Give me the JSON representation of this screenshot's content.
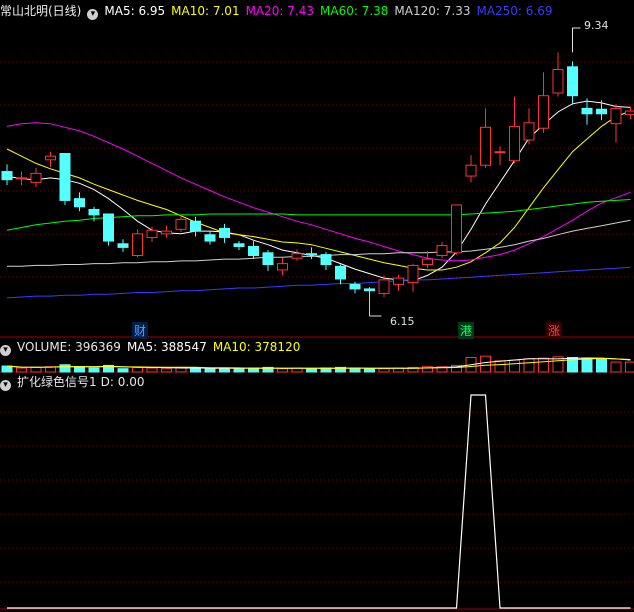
{
  "main": {
    "stock_name": "常山北明(日线)",
    "ma": [
      {
        "label": "MA5:",
        "value": "6.95",
        "color": "#ffffff"
      },
      {
        "label": "MA10:",
        "value": "7.01",
        "color": "#ffff00"
      },
      {
        "label": "MA20:",
        "value": "7.43",
        "color": "#ff00ff"
      },
      {
        "label": "MA60:",
        "value": "7.38",
        "color": "#00ff00"
      },
      {
        "label": "MA120:",
        "value": "7.33",
        "color": "#cfcfcf"
      },
      {
        "label": "MA250:",
        "value": "6.69",
        "color": "#3a3aff"
      }
    ],
    "high_label": "9.34",
    "low_label": "6.15",
    "markers": [
      {
        "text": "财",
        "color": "#4aa3ff",
        "bg": "#00204a"
      },
      {
        "text": "港",
        "color": "#00ff66",
        "bg": "#003a18"
      },
      {
        "text": "涨",
        "color": "#ff4040",
        "bg": "#3a0000"
      }
    ]
  },
  "volume": {
    "label": "VOLUME:",
    "value": "396369",
    "ma5_label": "MA5:",
    "ma5_value": "388547",
    "ma10_label": "MA10:",
    "ma10_value": "378120"
  },
  "indicator": {
    "name": "扩化绿色信号1",
    "d_label": "D:",
    "d_value": "0.00"
  },
  "chart_data": {
    "type": "candlestick",
    "y_high": 9.34,
    "y_low": 6.15,
    "candles": [
      [
        7.75,
        7.66,
        7.83,
        7.6
      ],
      [
        7.68,
        7.68,
        7.75,
        7.6
      ],
      [
        7.63,
        7.73,
        7.79,
        7.58
      ],
      [
        7.88,
        7.92,
        7.97,
        7.8
      ],
      [
        7.95,
        7.43,
        7.95,
        7.38
      ],
      [
        7.45,
        7.36,
        7.52,
        7.31
      ],
      [
        7.33,
        7.27,
        7.36,
        7.2
      ],
      [
        7.28,
        6.98,
        7.28,
        6.93
      ],
      [
        6.95,
        6.91,
        7.0,
        6.86
      ],
      [
        6.82,
        7.06,
        7.11,
        6.8
      ],
      [
        7.02,
        7.1,
        7.14,
        6.97
      ],
      [
        7.06,
        7.09,
        7.15,
        7.02
      ],
      [
        7.11,
        7.22,
        7.27,
        7.08
      ],
      [
        7.2,
        7.09,
        7.25,
        7.03
      ],
      [
        7.05,
        6.98,
        7.09,
        6.94
      ],
      [
        7.12,
        7.02,
        7.17,
        6.96
      ],
      [
        6.95,
        6.92,
        6.98,
        6.88
      ],
      [
        6.92,
        6.82,
        6.98,
        6.78
      ],
      [
        6.85,
        6.72,
        6.88,
        6.65
      ],
      [
        6.66,
        6.73,
        6.8,
        6.6
      ],
      [
        6.79,
        6.84,
        6.89,
        6.76
      ],
      [
        6.84,
        6.83,
        6.91,
        6.78
      ],
      [
        6.83,
        6.72,
        6.86,
        6.66
      ],
      [
        6.7,
        6.56,
        6.72,
        6.5
      ],
      [
        6.5,
        6.45,
        6.53,
        6.4
      ],
      [
        6.45,
        6.43,
        6.47,
        6.15
      ],
      [
        6.4,
        6.55,
        6.6,
        6.36
      ],
      [
        6.5,
        6.57,
        6.61,
        6.43
      ],
      [
        6.52,
        6.71,
        6.73,
        6.42
      ],
      [
        6.72,
        6.78,
        6.87,
        6.68
      ],
      [
        6.82,
        6.93,
        6.97,
        6.79
      ],
      [
        6.85,
        7.38,
        7.38,
        6.83
      ],
      [
        7.7,
        7.82,
        7.93,
        7.63
      ],
      [
        7.82,
        8.24,
        8.45,
        7.79
      ],
      [
        7.97,
        7.97,
        8.03,
        7.82
      ],
      [
        7.87,
        8.25,
        8.58,
        7.84
      ],
      [
        8.1,
        8.29,
        8.45,
        8.05
      ],
      [
        8.23,
        8.59,
        8.85,
        8.18
      ],
      [
        8.62,
        8.88,
        9.07,
        8.58
      ],
      [
        8.91,
        8.59,
        8.97,
        8.49
      ],
      [
        8.45,
        8.39,
        8.56,
        8.27
      ],
      [
        8.44,
        8.39,
        8.54,
        8.32
      ],
      [
        8.28,
        8.45,
        8.5,
        8.07
      ],
      [
        8.38,
        8.42,
        8.47,
        8.33
      ]
    ],
    "ma_lines": [
      {
        "name": "MA5",
        "color": "#ffffff",
        "v": [
          7.7,
          7.67,
          7.66,
          7.68,
          7.66,
          7.62,
          7.55,
          7.45,
          7.33,
          7.2,
          7.1,
          7.07,
          7.06,
          7.09,
          7.09,
          7.08,
          7.05,
          6.99,
          6.94,
          6.88,
          6.85,
          6.82,
          6.79,
          6.73,
          6.67,
          6.62,
          6.57,
          6.55,
          6.54,
          6.6,
          6.69,
          6.86,
          7.11,
          7.39,
          7.63,
          7.87,
          8.12,
          8.27,
          8.41,
          8.5,
          8.53,
          8.51,
          8.47,
          8.46
        ]
      },
      {
        "name": "MA10",
        "color": "#ffff00",
        "v": [
          8.0,
          7.92,
          7.84,
          7.78,
          7.73,
          7.68,
          7.61,
          7.55,
          7.49,
          7.43,
          7.38,
          7.33,
          7.26,
          7.19,
          7.13,
          7.07,
          7.05,
          7.03,
          7.0,
          6.97,
          6.96,
          6.94,
          6.9,
          6.86,
          6.82,
          6.78,
          6.74,
          6.71,
          6.68,
          6.66,
          6.66,
          6.69,
          6.75,
          6.85,
          6.96,
          7.13,
          7.35,
          7.57,
          7.77,
          7.97,
          8.11,
          8.25,
          8.36,
          8.42
        ]
      },
      {
        "name": "MA20",
        "color": "#ff00ff",
        "v": [
          8.25,
          8.28,
          8.29,
          8.28,
          8.24,
          8.2,
          8.14,
          8.07,
          8.0,
          7.92,
          7.84,
          7.76,
          7.68,
          7.61,
          7.54,
          7.47,
          7.41,
          7.35,
          7.3,
          7.25,
          7.2,
          7.16,
          7.11,
          7.06,
          7.01,
          6.97,
          6.92,
          6.87,
          6.83,
          6.79,
          6.77,
          6.76,
          6.77,
          6.8,
          6.83,
          6.88,
          6.95,
          7.03,
          7.12,
          7.21,
          7.31,
          7.4,
          7.46,
          7.52
        ]
      },
      {
        "name": "MA60",
        "color": "#00ff00",
        "v": [
          7.1,
          7.13,
          7.16,
          7.18,
          7.2,
          7.21,
          7.23,
          7.24,
          7.25,
          7.26,
          7.26,
          7.27,
          7.27,
          7.27,
          7.28,
          7.28,
          7.28,
          7.28,
          7.28,
          7.28,
          7.27,
          7.27,
          7.27,
          7.27,
          7.27,
          7.27,
          7.27,
          7.27,
          7.27,
          7.27,
          7.27,
          7.27,
          7.28,
          7.29,
          7.3,
          7.31,
          7.33,
          7.35,
          7.37,
          7.39,
          7.41,
          7.42,
          7.43,
          7.44
        ]
      },
      {
        "name": "MA120",
        "color": "#cfcfcf",
        "v": [
          6.7,
          6.7,
          6.71,
          6.71,
          6.72,
          6.72,
          6.73,
          6.73,
          6.74,
          6.74,
          6.75,
          6.75,
          6.76,
          6.76,
          6.77,
          6.78,
          6.78,
          6.79,
          6.8,
          6.8,
          6.81,
          6.81,
          6.82,
          6.83,
          6.83,
          6.84,
          6.84,
          6.85,
          6.85,
          6.85,
          6.86,
          6.86,
          6.87,
          6.89,
          6.91,
          6.94,
          6.98,
          7.01,
          7.05,
          7.09,
          7.12,
          7.15,
          7.18,
          7.21
        ]
      },
      {
        "name": "MA250",
        "color": "#3a3aff",
        "v": [
          6.35,
          6.36,
          6.37,
          6.37,
          6.38,
          6.38,
          6.39,
          6.39,
          6.4,
          6.41,
          6.41,
          6.42,
          6.43,
          6.43,
          6.44,
          6.45,
          6.46,
          6.46,
          6.47,
          6.48,
          6.49,
          6.49,
          6.5,
          6.51,
          6.51,
          6.52,
          6.53,
          6.54,
          6.55,
          6.55,
          6.56,
          6.57,
          6.58,
          6.59,
          6.6,
          6.61,
          6.62,
          6.63,
          6.64,
          6.65,
          6.66,
          6.67,
          6.68,
          6.69
        ]
      }
    ],
    "volume_bars": [
      18,
      12,
      14,
      16,
      22,
      16,
      12,
      20,
      10,
      14,
      12,
      10,
      14,
      12,
      10,
      12,
      10,
      12,
      14,
      10,
      12,
      10,
      12,
      14,
      12,
      10,
      10,
      12,
      14,
      16,
      16,
      20,
      44,
      48,
      34,
      36,
      40,
      42,
      46,
      44,
      40,
      38,
      30,
      30
    ],
    "signal_D": [
      0,
      0,
      0,
      0,
      0,
      0,
      0,
      0,
      0,
      0,
      0,
      0,
      0,
      0,
      0,
      0,
      0,
      0,
      0,
      0,
      0,
      0,
      0,
      0,
      0,
      0,
      0,
      0,
      0,
      0,
      0,
      0,
      1,
      1,
      0,
      0,
      0,
      0,
      0,
      0,
      0,
      0,
      0,
      0
    ]
  }
}
